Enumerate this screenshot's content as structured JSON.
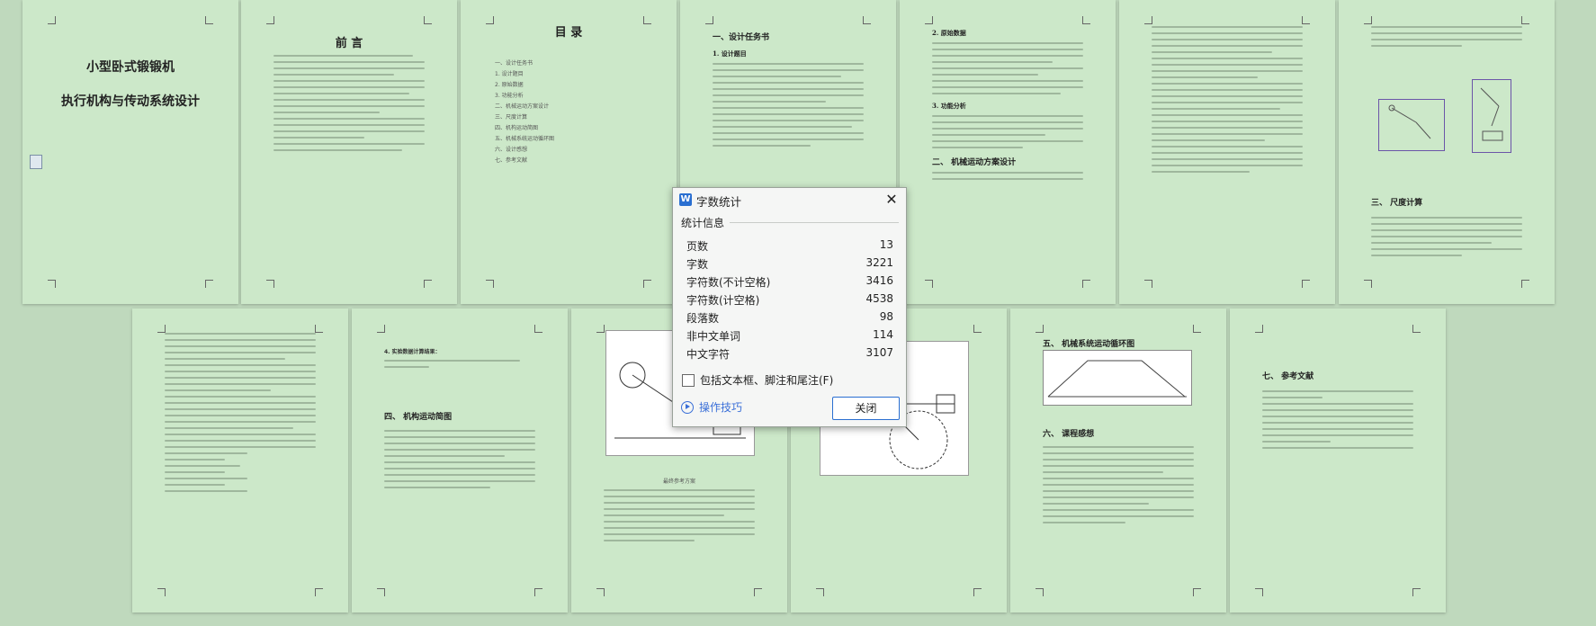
{
  "pages": {
    "p1": {
      "title1": "小型卧式锻锻机",
      "title2": "执行机构与传动系统设计"
    },
    "p2": {
      "heading": "前 言"
    },
    "p3": {
      "heading": "目 录",
      "toc": [
        "一、设计任务书",
        "1. 设计题目",
        "2. 原始数据",
        "3. 功能分析",
        "二、机械运动方案设计",
        "三、尺度计算",
        "四、机构运动简图",
        "五、机械系统运动循环图",
        "六、设计感想",
        "七、参考文献"
      ]
    },
    "p4": {
      "h1": "一、设计任务书",
      "h2": "1. 设计题目"
    },
    "p5": {
      "h1": "2. 原始数据",
      "h2": "3. 功能分析",
      "h3": "二、 机械运动方案设计"
    },
    "p7": {
      "h1": "三、 尺度计算"
    },
    "p9": {
      "h1": "四、 机构运动简图",
      "item": "4. 实验数据计算结果："
    },
    "p10": {
      "caption": "最终参考方案"
    },
    "p12": {
      "h1": "五、 机械系统运动循环图",
      "h2": "六、 课程感想"
    },
    "p13": {
      "h1": "七、 参考文献"
    }
  },
  "dialog": {
    "title": "字数统计",
    "section": "统计信息",
    "stats": [
      {
        "label": "页数",
        "value": "13"
      },
      {
        "label": "字数",
        "value": "3221"
      },
      {
        "label": "字符数(不计空格)",
        "value": "3416"
      },
      {
        "label": "字符数(计空格)",
        "value": "4538"
      },
      {
        "label": "段落数",
        "value": "98"
      },
      {
        "label": "非中文单词",
        "value": "114"
      },
      {
        "label": "中文字符",
        "value": "3107"
      }
    ],
    "checkbox_label": "包括文本框、脚注和尾注(F)",
    "tips_label": "操作技巧",
    "close_label": "关闭"
  }
}
